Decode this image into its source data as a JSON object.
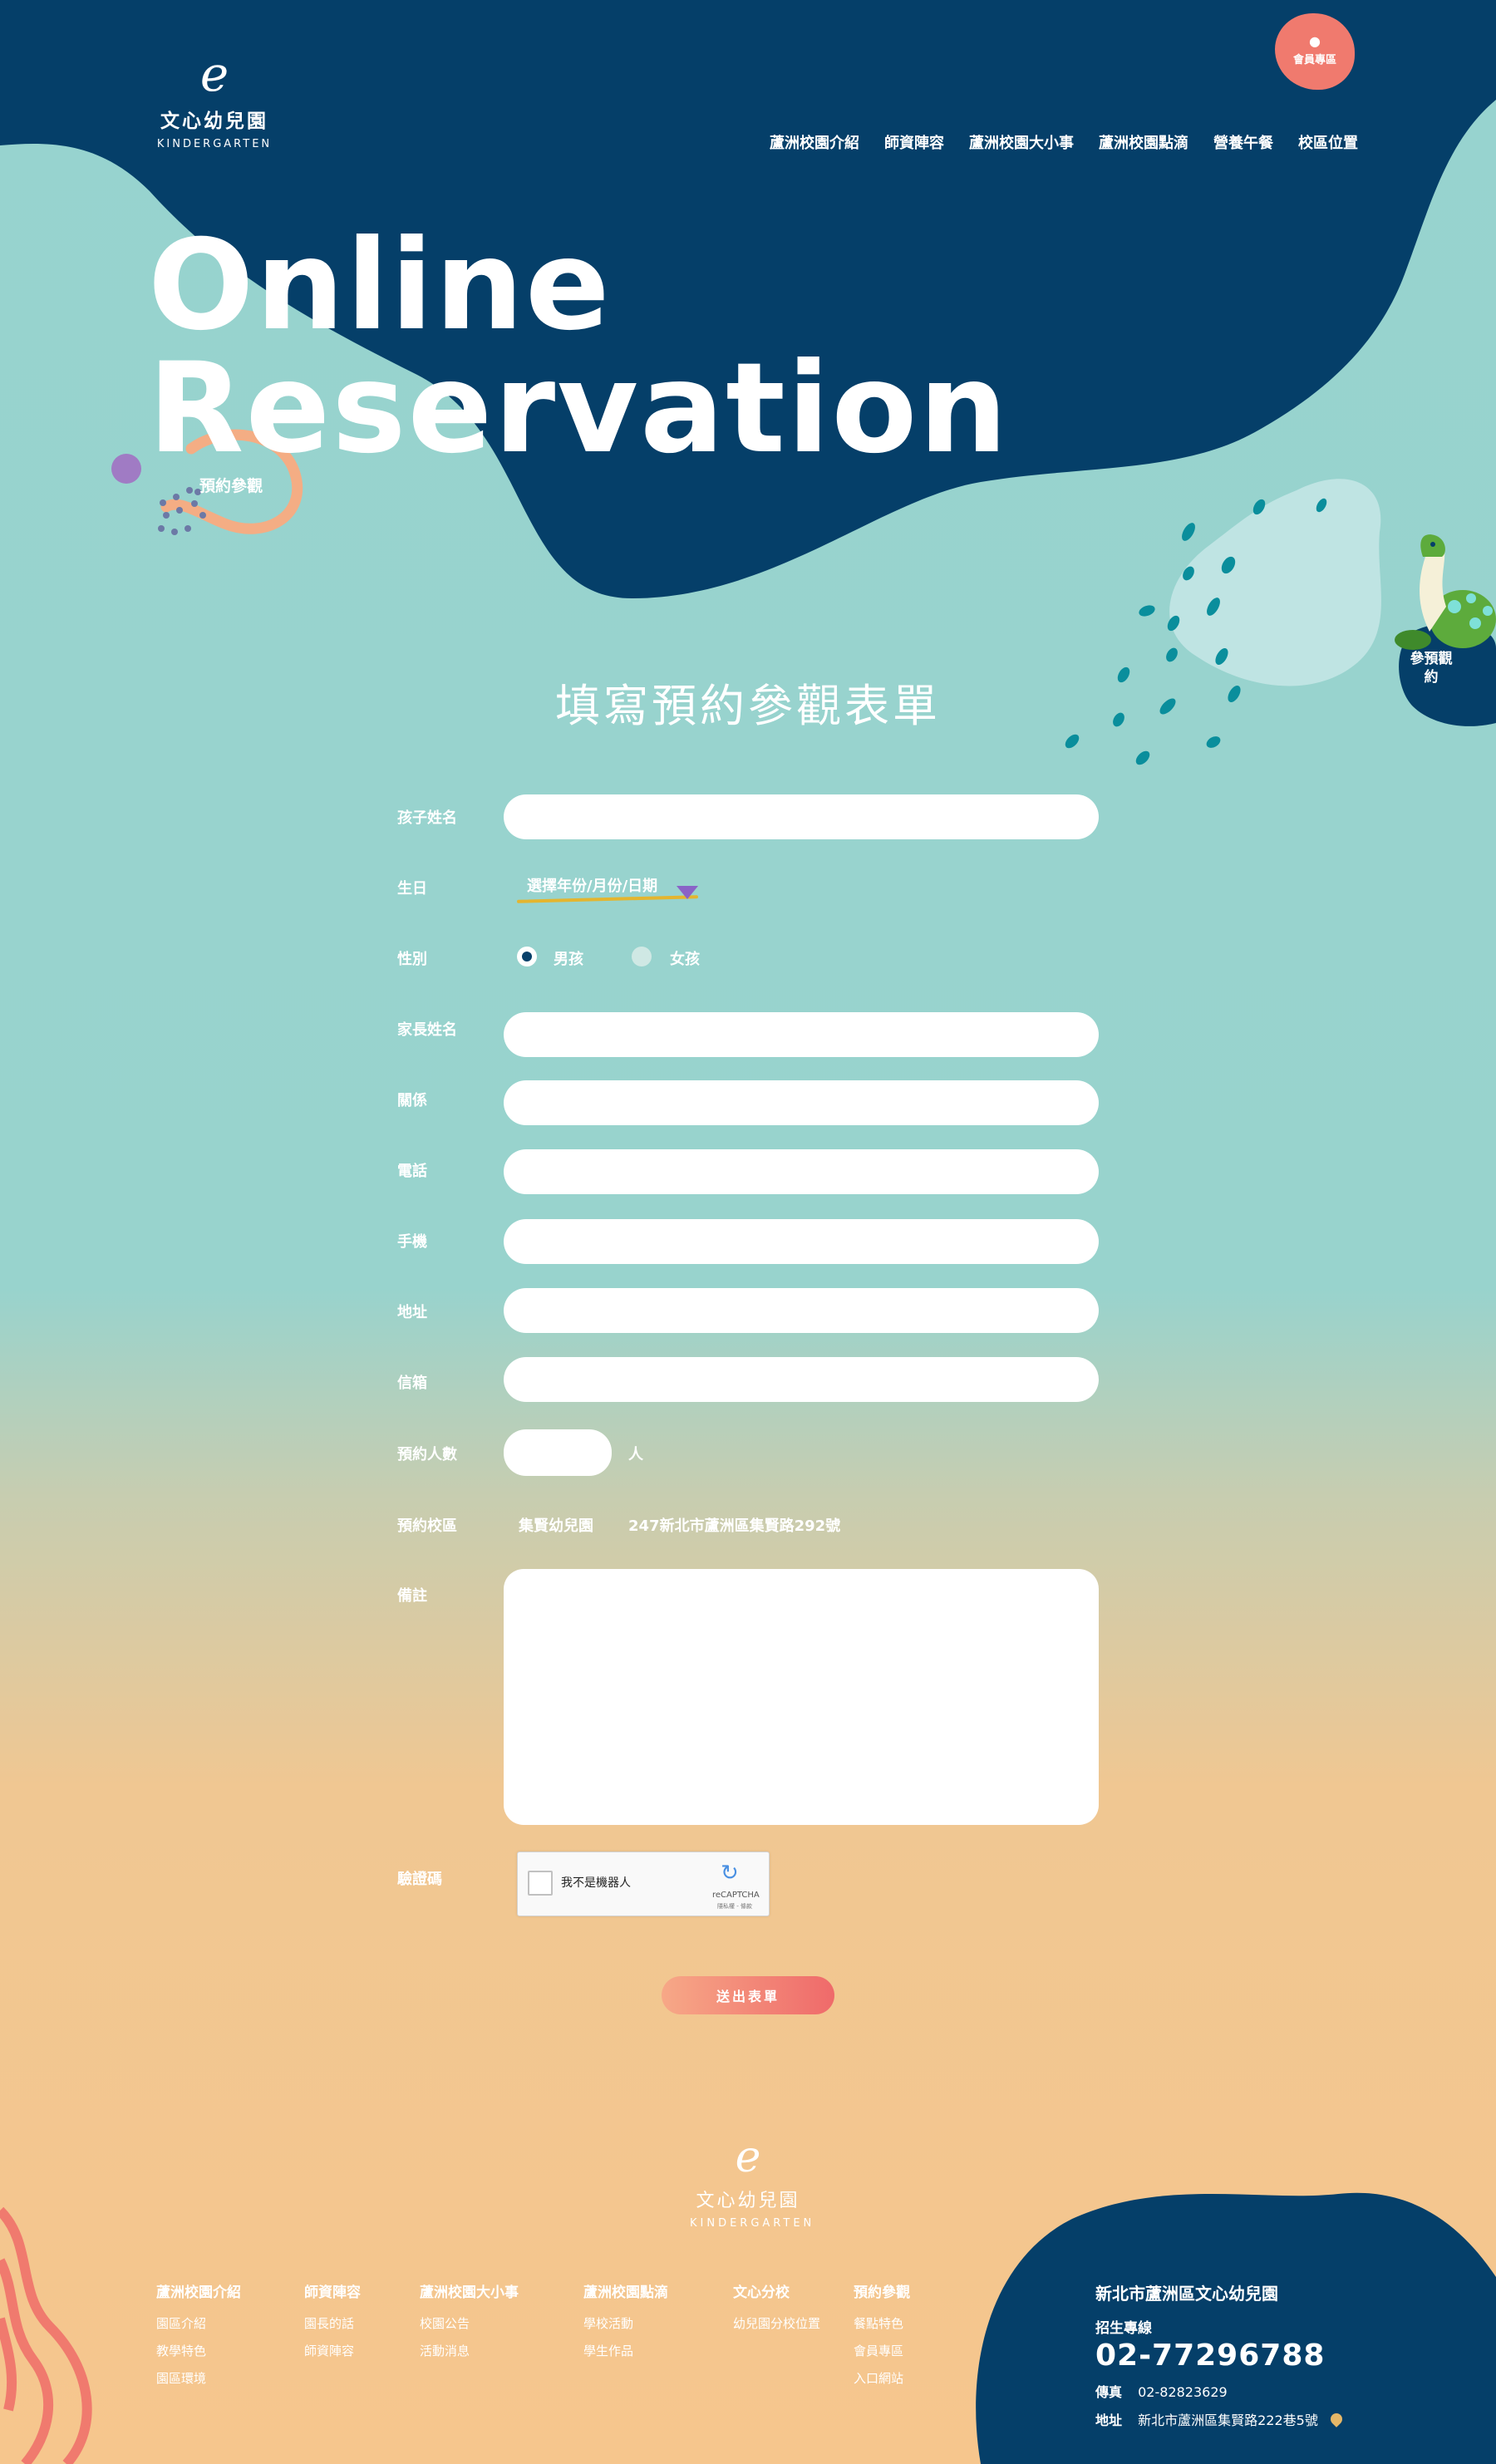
{
  "colors": {
    "navy": "#053f69",
    "teal_bg": "#97d3cf",
    "peach_bg": "#f6c68d",
    "coral": "#f07a6e",
    "white": "#ffffff"
  },
  "header": {
    "logo_mark": "e",
    "logo_name": "文心幼兒園",
    "logo_sub": "KINDERGARTEN",
    "member_icon": "user-icon",
    "member_label": "會員專區",
    "nav": [
      "蘆洲校園介紹",
      "師資陣容",
      "蘆洲校園大小事",
      "蘆洲校園點滴",
      "營養午餐",
      "校區位置"
    ]
  },
  "hero": {
    "title_line1": "Online",
    "title_line2": "Reservation",
    "tag": "預約參觀",
    "side_badge": "參預觀約"
  },
  "form": {
    "heading": "填寫預約參觀表單",
    "labels": {
      "child_name": "孩子姓名",
      "birthday": "生日",
      "gender": "性別",
      "parent_name": "家長姓名",
      "relation": "關係",
      "phone": "電話",
      "mobile": "手機",
      "address": "地址",
      "email": "信箱",
      "count": "預約人數",
      "campus": "預約校區",
      "notes": "備註",
      "captcha": "驗證碼"
    },
    "birthday_placeholder": "選擇年份/月份/日期",
    "gender_options": [
      "男孩",
      "女孩"
    ],
    "gender_selected": "男孩",
    "count_unit": "人",
    "campus_name": "集賢幼兒園",
    "campus_address": "247新北市蘆洲區集賢路292號",
    "captcha_text": "我不是機器人",
    "captcha_brand": "reCAPTCHA",
    "captcha_terms": "隱私權 - 條款",
    "submit": "送出表單"
  },
  "footer": {
    "logo_mark": "e",
    "logo_name": "文心幼兒園",
    "logo_sub": "KINDERGARTEN",
    "columns": [
      {
        "title": "蘆洲校園介紹",
        "items": [
          "園區介紹",
          "教學特色",
          "園區環境"
        ]
      },
      {
        "title": "師資陣容",
        "items": [
          "園長的話",
          "師資陣容"
        ]
      },
      {
        "title": "蘆洲校園大小事",
        "items": [
          "校園公告",
          "活動消息"
        ]
      },
      {
        "title": "蘆洲校園點滴",
        "items": [
          "學校活動",
          "學生作品"
        ]
      },
      {
        "title": "文心分校",
        "items": [
          "幼兒園分校位置"
        ]
      },
      {
        "title": "預約參觀",
        "items": [
          "餐點特色",
          "會員專區",
          "入口網站"
        ]
      }
    ],
    "contact": {
      "org": "新北市蘆洲區文心幼兒園",
      "hotline_label": "招生專線",
      "hotline": "02-77296788",
      "fax_label": "傳真",
      "fax": "02-82823629",
      "address_label": "地址",
      "address": "新北市蘆洲區集賢路222巷5號",
      "address_icon": "map-pin-icon"
    }
  }
}
